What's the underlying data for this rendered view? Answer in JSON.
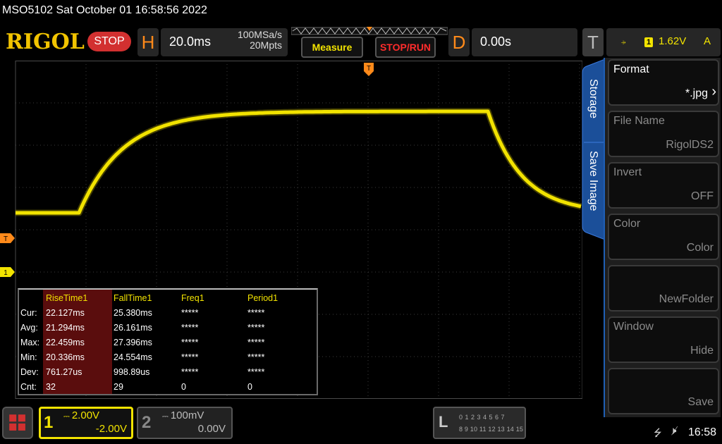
{
  "status_bar": {
    "title": "MSO5102  Sat October 01 16:58:56 2022"
  },
  "header": {
    "logo": "RIGOL",
    "run_state": "STOP",
    "horizontal": {
      "letter": "H",
      "timebase": "20.0ms",
      "sample_rate": "100MSa/s",
      "memory_depth": "20Mpts"
    },
    "measure_button": "Measure",
    "stoprun_button": "STOP/RUN",
    "delay": {
      "letter": "D",
      "value": "0.00s"
    },
    "trigger": {
      "letter": "T",
      "edge_icon": "rising-edge-icon",
      "edge_glyph": "⍆",
      "source_channel": "1",
      "level": "1.62V",
      "sweep_mode": "A"
    }
  },
  "markers": {
    "trigger_position": "T",
    "trigger_level_marker": "T",
    "ch1_ground_marker": "1"
  },
  "measurements": {
    "columns": [
      "RiseTime1",
      "FallTime1",
      "Freq1",
      "Period1"
    ],
    "rows": [
      {
        "label": "Cur:",
        "values": [
          "22.127ms",
          "25.380ms",
          "*****",
          "*****"
        ]
      },
      {
        "label": "Avg:",
        "values": [
          "21.294ms",
          "26.161ms",
          "*****",
          "*****"
        ]
      },
      {
        "label": "Max:",
        "values": [
          "22.459ms",
          "27.396ms",
          "*****",
          "*****"
        ]
      },
      {
        "label": "Min:",
        "values": [
          "20.336ms",
          "24.554ms",
          "*****",
          "*****"
        ]
      },
      {
        "label": "Dev:",
        "values": [
          "761.27us",
          "998.89us",
          "*****",
          "*****"
        ]
      },
      {
        "label": "Cnt:",
        "values": [
          "32",
          "29",
          "0",
          "0"
        ]
      }
    ]
  },
  "side_menu": {
    "tabs": [
      "Storage",
      "Save Image"
    ],
    "items": [
      {
        "title": "Format",
        "value": "*.jpg",
        "enabled": true
      },
      {
        "title": "File Name",
        "value": "RigolDS2",
        "enabled": false
      },
      {
        "title": "Invert",
        "value": "OFF",
        "enabled": false
      },
      {
        "title": "Color",
        "value": "Color",
        "enabled": false
      },
      {
        "title": "",
        "value": "NewFolder",
        "enabled": false
      },
      {
        "title": "Window",
        "value": "Hide",
        "enabled": false
      },
      {
        "title": "",
        "value": "Save",
        "enabled": false
      }
    ]
  },
  "channels": {
    "ch1": {
      "number": "1",
      "scale": "2.00V",
      "offset": "-2.00V",
      "coupling_icon": "dc-coupling-icon",
      "color": "#f2e300"
    },
    "ch2": {
      "number": "2",
      "scale": "100mV",
      "offset": "0.00V",
      "coupling_icon": "dc-coupling-icon",
      "color": "#888888"
    }
  },
  "logic_analyzer": {
    "letter": "L",
    "row1": "0 1 2 3   4 5 6 7",
    "row2": "8 9 10 11 12 13 14 15"
  },
  "system_tray": {
    "usb_icon": "usb-icon",
    "speaker_icon": "speaker-muted-icon",
    "time": "16:58"
  },
  "colors": {
    "waveform": "#f2e300",
    "accent_orange": "#ff8a1a",
    "stop_red": "#d23030",
    "menu_blue": "#1f5fb5"
  }
}
